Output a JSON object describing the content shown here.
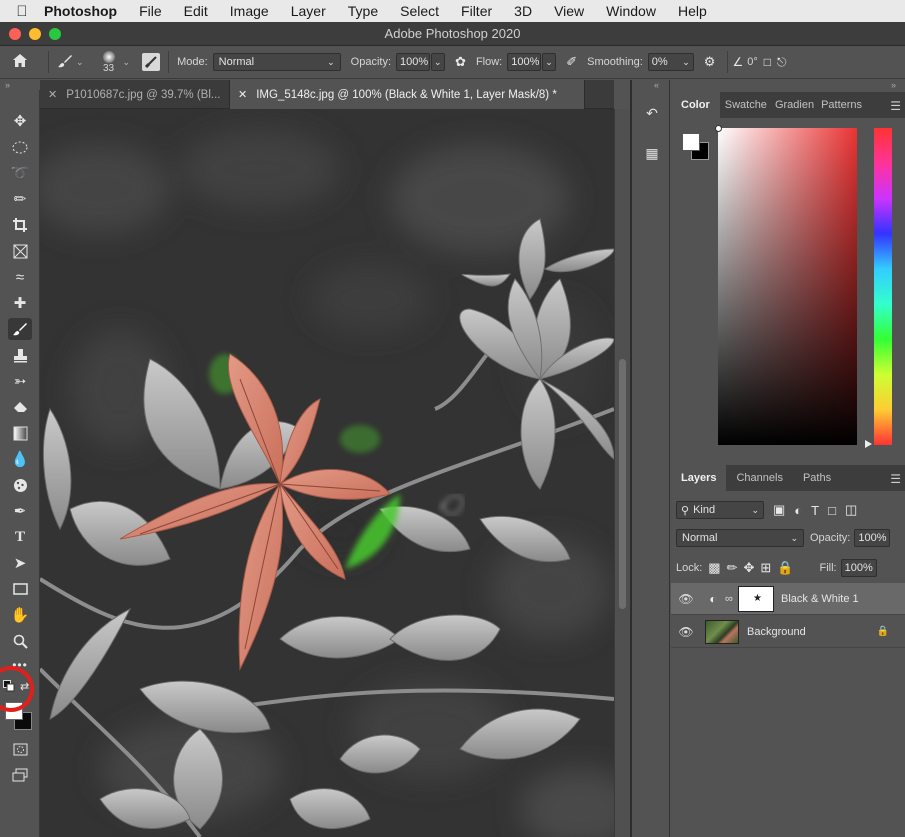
{
  "menubar": {
    "app": "Photoshop",
    "items": [
      "File",
      "Edit",
      "Image",
      "Layer",
      "Type",
      "Select",
      "Filter",
      "3D",
      "View",
      "Window",
      "Help"
    ]
  },
  "window": {
    "title": "Adobe Photoshop 2020"
  },
  "options": {
    "brush_size": "33",
    "mode_label": "Mode:",
    "mode_value": "Normal",
    "opacity_label": "Opacity:",
    "opacity_value": "100%",
    "flow_label": "Flow:",
    "flow_value": "100%",
    "smoothing_label": "Smoothing:",
    "smoothing_value": "0%",
    "angle_value": "0°"
  },
  "doc_tabs": [
    {
      "label": "P1010687c.jpg @ 39.7% (Bl...",
      "active": false
    },
    {
      "label": "IMG_5148c.jpg @ 100% (Black & White 1, Layer Mask/8) *",
      "active": true
    }
  ],
  "color_panel": {
    "tabs": [
      "Color",
      "Swatche",
      "Gradien",
      "Patterns"
    ],
    "active": "Color",
    "hue_color": "#ea3333"
  },
  "layers_panel": {
    "tabs": [
      "Layers",
      "Channels",
      "Paths"
    ],
    "filter_label": "Kind",
    "blend_mode": "Normal",
    "opacity_label": "Opacity:",
    "opacity_value": "100%",
    "lock_label": "Lock:",
    "fill_label": "Fill:",
    "fill_value": "100%",
    "layers": [
      {
        "name": "Black & White 1",
        "type": "adjustment",
        "selected": true
      },
      {
        "name": "Background",
        "type": "image",
        "locked": true
      }
    ]
  },
  "colors": {
    "accent_annotation": "#e0201a",
    "leaf_red": "#d98a78",
    "mask_green": "#49c92e"
  }
}
